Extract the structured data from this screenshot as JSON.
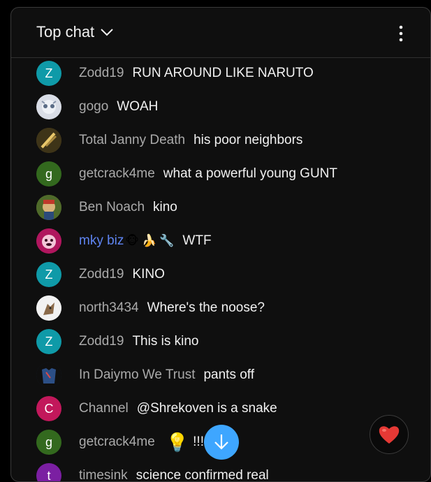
{
  "header": {
    "title": "Top chat",
    "chevron_icon": "chevron-down-icon",
    "menu_icon": "more-vert-icon"
  },
  "messages": [
    {
      "author": "Zodd19",
      "text": "RUN AROUND LIKE NARUTO",
      "avatar_letter": "Z",
      "avatar_color": "#0f9aa8"
    },
    {
      "author": "gogo",
      "text": "WOAH",
      "avatar_letter": "",
      "avatar_color": "#d9dde6"
    },
    {
      "author": "Total Janny Death",
      "text": "his poor neighbors",
      "avatar_letter": "",
      "avatar_color": "#5b4a1e"
    },
    {
      "author": "getcrack4me",
      "text": "what a powerful young GUNT",
      "avatar_letter": "g",
      "avatar_color": "#33691e"
    },
    {
      "author": "Ben Noach",
      "text": "kino",
      "avatar_letter": "",
      "avatar_color": "#6b7a2a"
    },
    {
      "author": "mky biz",
      "text": "WTF",
      "avatar_letter": "",
      "avatar_color": "#b0165e",
      "member": true,
      "emojis": [
        "🐵",
        "🍌",
        "🔧"
      ]
    },
    {
      "author": "Zodd19",
      "text": "KINO",
      "avatar_letter": "Z",
      "avatar_color": "#0f9aa8"
    },
    {
      "author": "north3434",
      "text": "Where's the noose?",
      "avatar_letter": "",
      "avatar_color": "#f2f2f2"
    },
    {
      "author": "Zodd19",
      "text": "This is kino",
      "avatar_letter": "Z",
      "avatar_color": "#0f9aa8"
    },
    {
      "author": "In Daiymo We Trust",
      "text": "pants off",
      "avatar_letter": "",
      "avatar_color": "#1a2a44"
    },
    {
      "author": "Channel",
      "text": "@Shrekoven is a snake",
      "avatar_letter": "C",
      "avatar_color": "#c2185b"
    },
    {
      "author": "getcrack4me",
      "text": "!!!",
      "avatar_letter": "g",
      "avatar_color": "#33691e",
      "emojis": [
        "💡"
      ]
    },
    {
      "author": "timesink",
      "text": "science confirmed real",
      "avatar_letter": "t",
      "avatar_color": "#7b1fa2"
    }
  ],
  "scroll_button": {
    "icon": "arrow-down-icon",
    "color": "#3ea6ff"
  },
  "reaction_button": {
    "icon": "heart-icon",
    "color": "#e53935"
  }
}
